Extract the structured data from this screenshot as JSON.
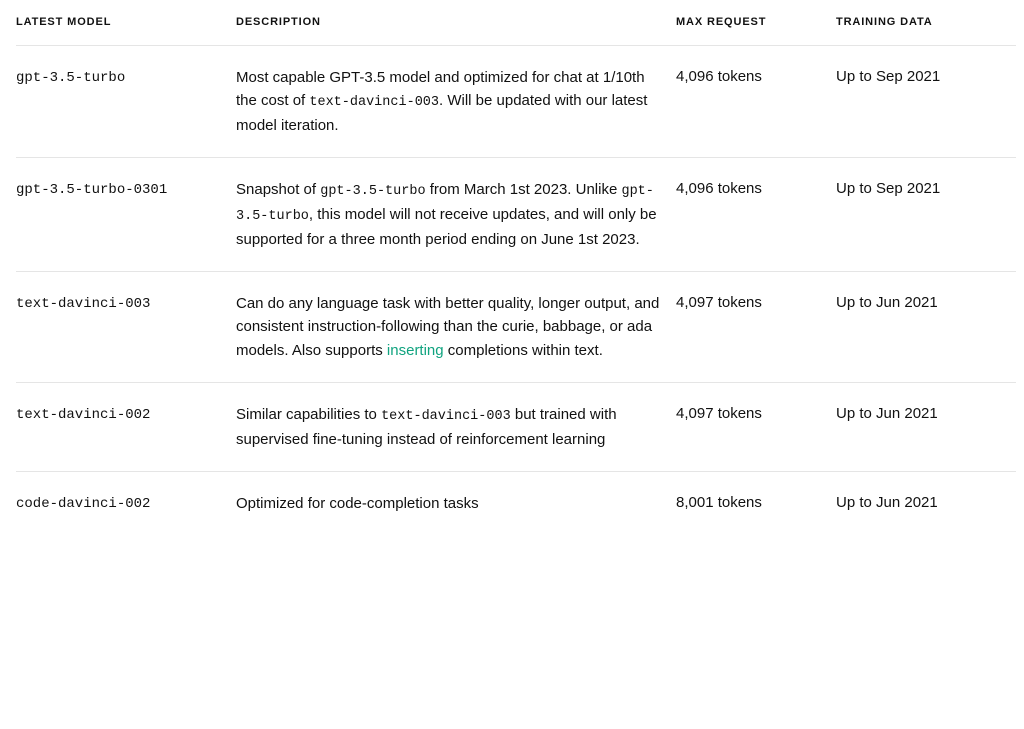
{
  "table": {
    "columns": [
      {
        "key": "model",
        "label": "LATEST MODEL"
      },
      {
        "key": "description",
        "label": "DESCRIPTION"
      },
      {
        "key": "max_request",
        "label": "MAX REQUEST"
      },
      {
        "key": "training_data",
        "label": "TRAINING DATA"
      }
    ],
    "rows": [
      {
        "model": "gpt-3.5-turbo",
        "description_parts": [
          {
            "type": "text",
            "content": "Most capable GPT-3.5 model and optimized for chat at 1/10th the cost of "
          },
          {
            "type": "code",
            "content": "text-davinci-003"
          },
          {
            "type": "text",
            "content": ". Will be updated with our latest model iteration."
          }
        ],
        "max_request": "4,096 tokens",
        "training_data": "Up to Sep 2021"
      },
      {
        "model": "gpt-3.5-turbo-0301",
        "description_parts": [
          {
            "type": "text",
            "content": "Snapshot of "
          },
          {
            "type": "code",
            "content": "gpt-3.5-turbo"
          },
          {
            "type": "text",
            "content": " from March 1st 2023. Unlike "
          },
          {
            "type": "code",
            "content": "gpt-3.5-turbo"
          },
          {
            "type": "text",
            "content": ", this model will not receive updates, and will only be supported for a three month period ending on June 1st 2023."
          }
        ],
        "max_request": "4,096 tokens",
        "training_data": "Up to Sep 2021"
      },
      {
        "model": "text-davinci-003",
        "description_parts": [
          {
            "type": "text",
            "content": "Can do any language task with better quality, longer output, and consistent instruction-following than the curie, babbage, or ada models. Also supports "
          },
          {
            "type": "link",
            "content": "inserting",
            "href": "#"
          },
          {
            "type": "text",
            "content": " completions within text."
          }
        ],
        "max_request": "4,097 tokens",
        "training_data": "Up to Jun 2021"
      },
      {
        "model": "text-davinci-002",
        "description_parts": [
          {
            "type": "text",
            "content": "Similar capabilities to "
          },
          {
            "type": "code",
            "content": "text-davinci-003"
          },
          {
            "type": "text",
            "content": " but trained with supervised fine-tuning instead of reinforcement learning"
          }
        ],
        "max_request": "4,097 tokens",
        "training_data": "Up to Jun 2021"
      },
      {
        "model": "code-davinci-002",
        "description_parts": [
          {
            "type": "text",
            "content": "Optimized for code-completion tasks"
          }
        ],
        "max_request": "8,001 tokens",
        "training_data": "Up to Jun 2021"
      }
    ]
  }
}
